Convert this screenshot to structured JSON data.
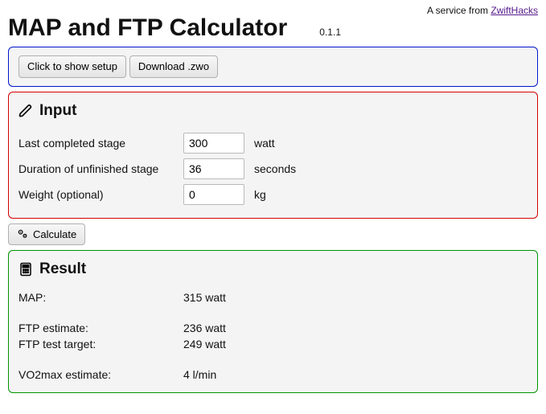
{
  "service": {
    "prefix": "A service from ",
    "link_text": "ZwiftHacks"
  },
  "title": "MAP and FTP Calculator",
  "version": "0.1.1",
  "toolbar": {
    "show_setup_label": "Click to show setup",
    "download_label": "Download .zwo"
  },
  "input": {
    "heading": "Input",
    "stage_label": "Last completed stage",
    "stage_value": "300",
    "stage_unit": "watt",
    "duration_label": "Duration of unfinished stage",
    "duration_value": "36",
    "duration_unit": "seconds",
    "weight_label": "Weight (optional)",
    "weight_value": "0",
    "weight_unit": "kg"
  },
  "calculate_label": "Calculate",
  "result": {
    "heading": "Result",
    "map_label": "MAP:",
    "map_value": "315 watt",
    "ftp_est_label": "FTP estimate:",
    "ftp_est_value": "236 watt",
    "ftp_target_label": "FTP test target:",
    "ftp_target_value": "249 watt",
    "vo2_label": "VO2max estimate:",
    "vo2_value": "4 l/min"
  }
}
